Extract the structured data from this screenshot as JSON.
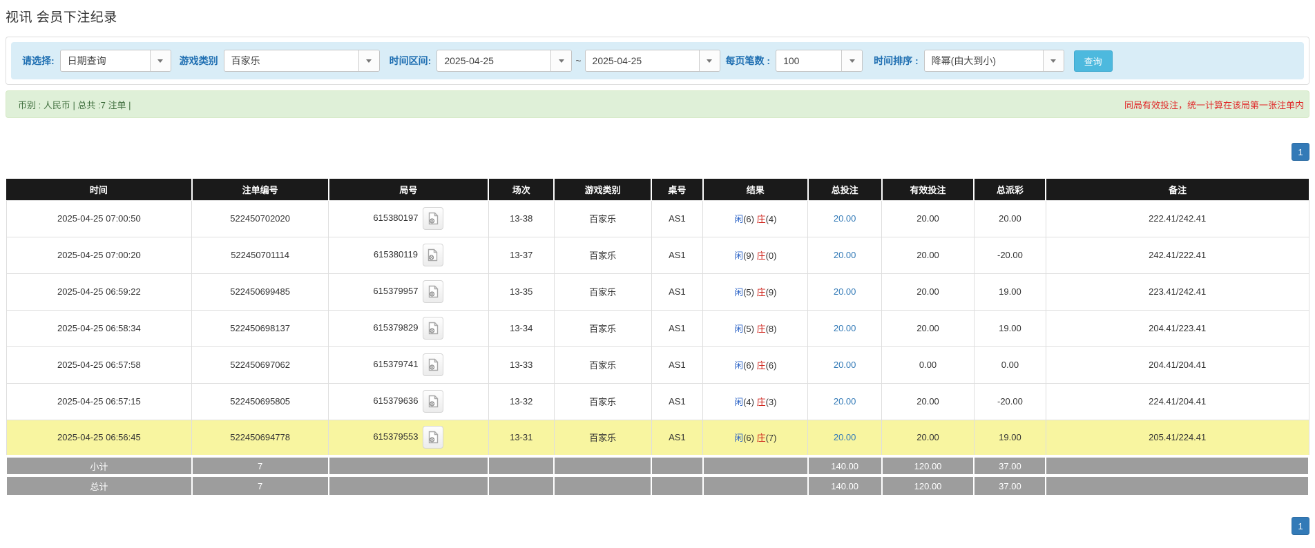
{
  "page": {
    "title": "视讯 会员下注纪录"
  },
  "filter_bar": {
    "query_type": {
      "label": "请选择:",
      "value": "日期查询"
    },
    "game_category": {
      "label": "游戏类别",
      "value": "百家乐"
    },
    "time_range": {
      "label": "时间区间:",
      "from": "2025-04-25",
      "separator": "~",
      "to": "2025-04-25"
    },
    "page_size": {
      "label": "每页笔数 :",
      "value": "100"
    },
    "time_sort": {
      "label": "时间排序 :",
      "value": "降幂(由大到小)"
    },
    "search_button": "查询"
  },
  "summary_bar": {
    "left": "币别 : 人民币 | 总共 :7 注单 |",
    "right": "同局有效投注，统一计算在该局第一张注单内"
  },
  "pagination": {
    "page": "1"
  },
  "icons": {
    "video_icon": "video-record-icon",
    "dropdown_icon": "chevron-down-icon"
  },
  "colors": {
    "accent_blue": "#337ab7",
    "info_bg": "#d9edf7",
    "success_bg": "#dff0d8",
    "warning_row": "#f8f5a0",
    "negative_red": "#e32222",
    "player_blue": "#2b63c6",
    "banker_red": "#cf2219"
  },
  "table": {
    "headers": [
      "时间",
      "注单编号",
      "局号",
      "场次",
      "游戏类别",
      "桌号",
      "结果",
      "总投注",
      "有效投注",
      "总派彩",
      "备注"
    ],
    "col_widths": [
      "14.25%",
      "10.49%",
      "12.29%",
      "5.03%",
      "7.47%",
      "3.97%",
      "8.05%",
      "5.67%",
      "7.10%",
      "5.51%",
      "20.18%"
    ],
    "rows": [
      {
        "time": "2025-04-25 07:00:50",
        "bet_no": "522450702020",
        "round_no": "615380197",
        "session": "13-38",
        "game": "百家乐",
        "table_no": "AS1",
        "player_label": "闲",
        "player_score": "(6)",
        "banker_label": "庄",
        "banker_score": "(4)",
        "total_bet": "20.00",
        "valid_bet": "20.00",
        "payout": "20.00",
        "payout_negative": false,
        "remark": "222.41/242.41",
        "highlight": false
      },
      {
        "time": "2025-04-25 07:00:20",
        "bet_no": "522450701114",
        "round_no": "615380119",
        "session": "13-37",
        "game": "百家乐",
        "table_no": "AS1",
        "player_label": "闲",
        "player_score": "(9)",
        "banker_label": "庄",
        "banker_score": "(0)",
        "total_bet": "20.00",
        "valid_bet": "20.00",
        "payout": "-20.00",
        "payout_negative": true,
        "remark": "242.41/222.41",
        "highlight": false
      },
      {
        "time": "2025-04-25 06:59:22",
        "bet_no": "522450699485",
        "round_no": "615379957",
        "session": "13-35",
        "game": "百家乐",
        "table_no": "AS1",
        "player_label": "闲",
        "player_score": "(5)",
        "banker_label": "庄",
        "banker_score": "(9)",
        "total_bet": "20.00",
        "valid_bet": "20.00",
        "payout": "19.00",
        "payout_negative": false,
        "remark": "223.41/242.41",
        "highlight": false
      },
      {
        "time": "2025-04-25 06:58:34",
        "bet_no": "522450698137",
        "round_no": "615379829",
        "session": "13-34",
        "game": "百家乐",
        "table_no": "AS1",
        "player_label": "闲",
        "player_score": "(5)",
        "banker_label": "庄",
        "banker_score": "(8)",
        "total_bet": "20.00",
        "valid_bet": "20.00",
        "payout": "19.00",
        "payout_negative": false,
        "remark": "204.41/223.41",
        "highlight": false
      },
      {
        "time": "2025-04-25 06:57:58",
        "bet_no": "522450697062",
        "round_no": "615379741",
        "session": "13-33",
        "game": "百家乐",
        "table_no": "AS1",
        "player_label": "闲",
        "player_score": "(6)",
        "banker_label": "庄",
        "banker_score": "(6)",
        "total_bet": "20.00",
        "valid_bet": "0.00",
        "payout": "0.00",
        "payout_negative": false,
        "remark": "204.41/204.41",
        "highlight": false
      },
      {
        "time": "2025-04-25 06:57:15",
        "bet_no": "522450695805",
        "round_no": "615379636",
        "session": "13-32",
        "game": "百家乐",
        "table_no": "AS1",
        "player_label": "闲",
        "player_score": "(4)",
        "banker_label": "庄",
        "banker_score": "(3)",
        "total_bet": "20.00",
        "valid_bet": "20.00",
        "payout": "-20.00",
        "payout_negative": true,
        "remark": "224.41/204.41",
        "highlight": false
      },
      {
        "time": "2025-04-25 06:56:45",
        "bet_no": "522450694778",
        "round_no": "615379553",
        "session": "13-31",
        "game": "百家乐",
        "table_no": "AS1",
        "player_label": "闲",
        "player_score": "(6)",
        "banker_label": "庄",
        "banker_score": "(7)",
        "total_bet": "20.00",
        "valid_bet": "20.00",
        "payout": "19.00",
        "payout_negative": false,
        "remark": "205.41/224.41",
        "highlight": true
      }
    ],
    "subtotal": {
      "label": "小计",
      "count": "7",
      "total_bet": "140.00",
      "valid_bet": "120.00",
      "payout": "37.00"
    },
    "total": {
      "label": "总计",
      "count": "7",
      "total_bet": "140.00",
      "valid_bet": "120.00",
      "payout": "37.00"
    }
  }
}
